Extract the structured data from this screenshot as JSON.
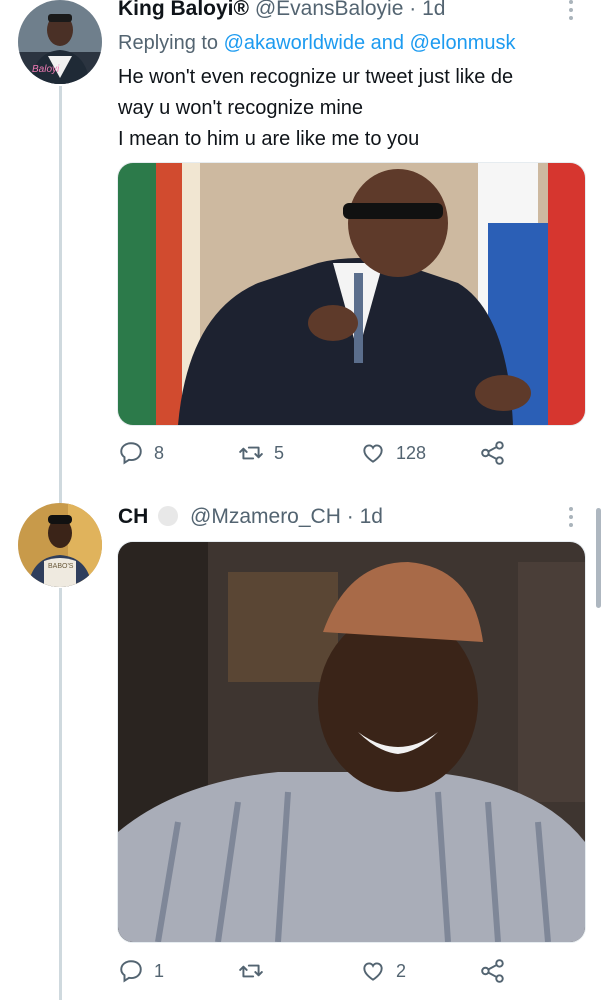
{
  "tweets": [
    {
      "name": "King Baloyi®",
      "handle": "@EvansBaloyie",
      "separator": "·",
      "time": "1d",
      "replying_prefix": "Replying to",
      "replying_users": "@akaworldwide and @elonmusk",
      "text_lines": [
        "He won't even recognize ur tweet just like de",
        "way u won't recognize mine",
        "I mean to him u are like me to you"
      ],
      "avatar_text": "Baloyi",
      "stats": {
        "replies": "8",
        "retweets": "5",
        "likes": "128"
      }
    },
    {
      "name": "CH",
      "handle": "@Mzamero_CH",
      "separator": "·",
      "time": "1d",
      "avatar_text": "BABO'S",
      "stats": {
        "replies": "1",
        "retweets": "",
        "likes": "2"
      }
    }
  ],
  "colors": {
    "link": "#1d9bf0",
    "secondary_text": "#536471",
    "thread_line": "#cfd9de"
  },
  "icons": [
    "reply-icon",
    "retweet-icon",
    "like-icon",
    "share-icon",
    "more-icon"
  ]
}
